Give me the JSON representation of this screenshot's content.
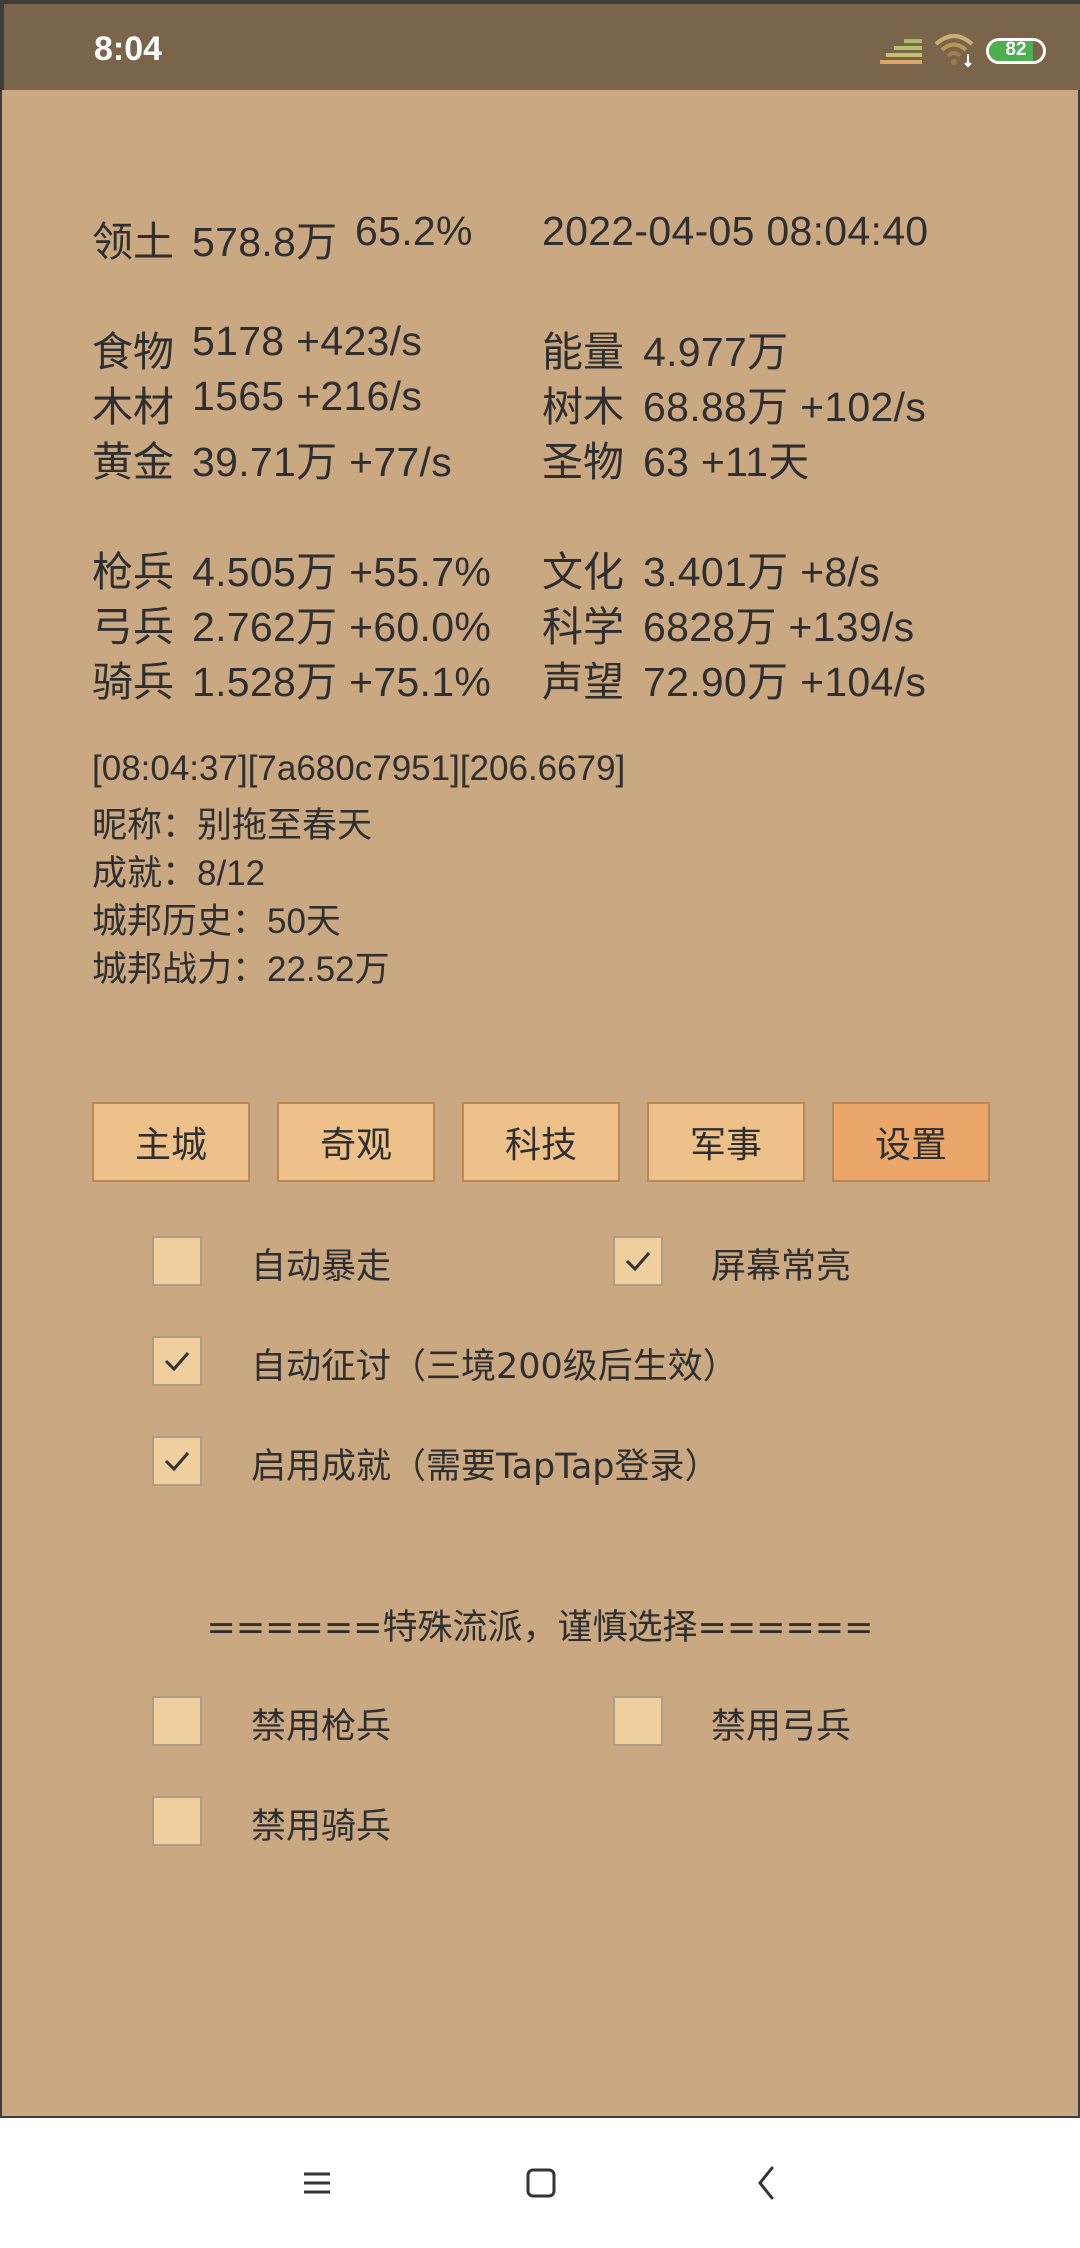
{
  "status_bar": {
    "time": "8:04",
    "battery": "82",
    "battery_level": 0.82,
    "icons": [
      "signal-icon",
      "wifi-icon",
      "battery-icon"
    ]
  },
  "header": {
    "territory_label": "领土",
    "territory_value": "578.8万",
    "territory_percent": "65.2%",
    "datetime": "2022-04-05 08:04:40"
  },
  "resources_left": [
    {
      "label": "食物",
      "value": "5178 +423/s"
    },
    {
      "label": "木材",
      "value": "1565 +216/s"
    },
    {
      "label": "黄金",
      "value": "39.71万 +77/s"
    }
  ],
  "resources_right": [
    {
      "label": "能量",
      "value": "4.977万"
    },
    {
      "label": "树木",
      "value": "68.88万 +102/s"
    },
    {
      "label": "圣物",
      "value": "63 +11天"
    }
  ],
  "military": [
    {
      "label": "枪兵",
      "value": "4.505万 +55.7%"
    },
    {
      "label": "弓兵",
      "value": "2.762万 +60.0%"
    },
    {
      "label": "骑兵",
      "value": "1.528万 +75.1%"
    }
  ],
  "culture": [
    {
      "label": "文化",
      "value": "3.401万 +8/s"
    },
    {
      "label": "科学",
      "value": "6828万 +139/s"
    },
    {
      "label": "声望",
      "value": "72.90万 +104/s"
    }
  ],
  "info": {
    "session": "[08:04:37][7a680c7951][206.6679]",
    "nickname": "昵称：别拖至春天",
    "achievements": "成就：8/12",
    "history": "城邦历史：50天",
    "power": "城邦战力：22.52万"
  },
  "tabs": [
    "主城",
    "奇观",
    "科技",
    "军事",
    "设置"
  ],
  "active_tab": "设置",
  "settings": {
    "auto_rampage": {
      "label": "自动暴走",
      "checked": false
    },
    "screen_on": {
      "label": "屏幕常亮",
      "checked": true
    },
    "auto_expedition": {
      "label": "自动征讨（三境200级后生效）",
      "checked": true
    },
    "enable_achievements": {
      "label": "启用成就（需要TapTap登录）",
      "checked": true
    },
    "special_header": "======特殊流派，谨慎选择======",
    "disable_spear": {
      "label": "禁用枪兵",
      "checked": false
    },
    "disable_archer": {
      "label": "禁用弓兵",
      "checked": false
    },
    "disable_cavalry": {
      "label": "禁用骑兵",
      "checked": false
    }
  },
  "nav": [
    "menu-icon",
    "home-icon",
    "back-icon"
  ]
}
